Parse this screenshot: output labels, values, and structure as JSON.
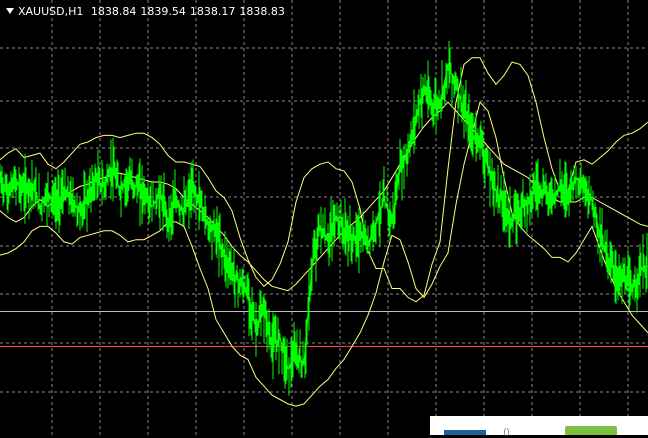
{
  "chart_header": {
    "symbol_timeframe": "XAUUSD,H1",
    "open": "1838.84",
    "high": "1839.54",
    "low": "1838.17",
    "close": "1838.83"
  },
  "colors": {
    "background": "#000000",
    "grid": "#8a8a8a",
    "price": "#00ff00",
    "bands": "#ffff80",
    "hline_gray": "#bdbdbd",
    "hline_red": "#ff3b3b"
  },
  "chart_data": {
    "type": "line",
    "title": "XAUUSD,H1",
    "grid": true,
    "x_index": [
      0,
      8,
      16,
      24,
      32,
      40,
      48,
      56,
      64,
      72,
      80,
      88,
      96,
      104,
      112,
      120,
      128,
      136,
      144,
      152,
      160,
      168,
      176,
      184,
      192,
      200,
      208,
      216,
      224,
      232,
      240,
      248,
      256,
      264,
      272,
      280,
      288,
      296,
      304,
      312,
      320,
      328,
      336,
      344,
      352,
      360,
      368,
      376,
      384,
      392,
      400,
      408,
      416,
      424,
      432,
      440,
      448,
      456,
      464,
      472,
      480,
      488,
      496,
      504,
      512,
      520,
      528,
      536,
      544,
      552,
      560,
      568,
      576,
      584,
      592,
      600,
      608,
      616,
      624,
      632,
      640,
      648
    ],
    "series": [
      {
        "values": [
          1839.05,
          1838.99,
          1839.04,
          1839.0,
          1839.03,
          1838.93,
          1838.99,
          1838.94,
          1838.99,
          1838.96,
          1838.9,
          1838.97,
          1839.05,
          1839.02,
          1839.1,
          1839.0,
          1839.05,
          1839.02,
          1838.99,
          1838.93,
          1838.98,
          1838.87,
          1838.95,
          1838.91,
          1839.0,
          1838.95,
          1838.85,
          1838.82,
          1838.71,
          1838.64,
          1838.58,
          1838.54,
          1838.38,
          1838.46,
          1838.3,
          1838.34,
          1838.2,
          1838.26,
          1838.22,
          1838.66,
          1838.84,
          1838.77,
          1838.88,
          1838.82,
          1838.78,
          1838.8,
          1838.76,
          1838.86,
          1838.96,
          1838.86,
          1839.1,
          1839.17,
          1839.34,
          1839.46,
          1839.38,
          1839.4,
          1839.56,
          1839.48,
          1839.36,
          1839.25,
          1839.24,
          1839.1,
          1839.0,
          1838.94,
          1838.86,
          1838.92,
          1838.96,
          1839.02,
          1839.0,
          1838.97,
          1839.02,
          1839.0,
          1839.06,
          1839.0,
          1838.96,
          1838.8,
          1838.7,
          1838.62,
          1838.6,
          1838.55,
          1838.64,
          1838.66
        ]
      },
      {
        "values": [
          1839.14,
          1839.17,
          1839.19,
          1839.15,
          1839.16,
          1839.17,
          1839.12,
          1839.1,
          1839.13,
          1839.17,
          1839.21,
          1839.22,
          1839.24,
          1839.25,
          1839.25,
          1839.24,
          1839.25,
          1839.26,
          1839.26,
          1839.24,
          1839.21,
          1839.16,
          1839.13,
          1839.13,
          1839.12,
          1839.11,
          1839.06,
          1839.0,
          1838.97,
          1838.91,
          1838.79,
          1838.69,
          1838.61,
          1838.57,
          1838.6,
          1838.67,
          1838.77,
          1838.95,
          1839.06,
          1839.1,
          1839.12,
          1839.13,
          1839.1,
          1839.09,
          1839.04,
          1838.92,
          1838.73,
          1838.65,
          1838.65,
          1838.56,
          1838.56,
          1838.52,
          1838.5,
          1838.53,
          1838.67,
          1838.77,
          1839.1,
          1839.4,
          1839.57,
          1839.6,
          1839.6,
          1839.53,
          1839.48,
          1839.52,
          1839.58,
          1839.57,
          1839.52,
          1839.4,
          1839.24,
          1839.1,
          1839.0,
          1839.0,
          1839.13,
          1839.14,
          1839.12,
          1839.15,
          1839.18,
          1839.22,
          1839.25,
          1839.26,
          1839.28,
          1839.31
        ]
      },
      {
        "values": [
          1838.91,
          1838.88,
          1838.86,
          1838.88,
          1838.93,
          1838.96,
          1838.93,
          1838.96,
          1838.98,
          1839.0,
          1839.02,
          1839.03,
          1839.05,
          1839.06,
          1839.07,
          1839.08,
          1839.07,
          1839.06,
          1839.05,
          1839.04,
          1839.04,
          1839.03,
          1839.01,
          1838.97,
          1838.94,
          1838.91,
          1838.88,
          1838.84,
          1838.8,
          1838.75,
          1838.71,
          1838.68,
          1838.64,
          1838.6,
          1838.57,
          1838.56,
          1838.55,
          1838.58,
          1838.62,
          1838.66,
          1838.7,
          1838.74,
          1838.78,
          1838.82,
          1838.85,
          1838.88,
          1838.92,
          1838.96,
          1839.0,
          1839.06,
          1839.12,
          1839.18,
          1839.24,
          1839.29,
          1839.33,
          1839.36,
          1839.4,
          1839.36,
          1839.32,
          1839.28,
          1839.24,
          1839.2,
          1839.16,
          1839.12,
          1839.1,
          1839.08,
          1839.06,
          1839.02,
          1838.99,
          1838.97,
          1838.95,
          1838.95,
          1838.95,
          1838.97,
          1838.97,
          1838.95,
          1838.93,
          1838.91,
          1838.89,
          1838.87,
          1838.85,
          1838.84
        ]
      },
      {
        "values": [
          1838.71,
          1838.72,
          1838.74,
          1838.77,
          1838.82,
          1838.84,
          1838.84,
          1838.81,
          1838.77,
          1838.76,
          1838.79,
          1838.8,
          1838.81,
          1838.82,
          1838.82,
          1838.8,
          1838.77,
          1838.78,
          1838.78,
          1838.8,
          1838.82,
          1838.86,
          1838.86,
          1838.84,
          1838.75,
          1838.65,
          1838.56,
          1838.42,
          1838.36,
          1838.3,
          1838.26,
          1838.24,
          1838.16,
          1838.12,
          1838.08,
          1838.06,
          1838.04,
          1838.03,
          1838.04,
          1838.08,
          1838.12,
          1838.15,
          1838.2,
          1838.24,
          1838.3,
          1838.36,
          1838.44,
          1838.54,
          1838.68,
          1838.8,
          1838.78,
          1838.68,
          1838.56,
          1838.52,
          1838.58,
          1838.66,
          1838.72,
          1838.94,
          1839.12,
          1839.26,
          1839.4,
          1839.36,
          1839.24,
          1839.06,
          1838.9,
          1838.84,
          1838.8,
          1838.77,
          1838.74,
          1838.7,
          1838.7,
          1838.68,
          1838.72,
          1838.78,
          1838.84,
          1838.74,
          1838.64,
          1838.56,
          1838.5,
          1838.44,
          1838.4,
          1838.36
        ]
      }
    ],
    "ylim": [
      1837.9,
      1839.86
    ],
    "hlines": [
      {
        "value": 1838.46,
        "color": "#bdbdbd"
      },
      {
        "value": 1838.3,
        "color": "#ff3b3b"
      }
    ]
  }
}
